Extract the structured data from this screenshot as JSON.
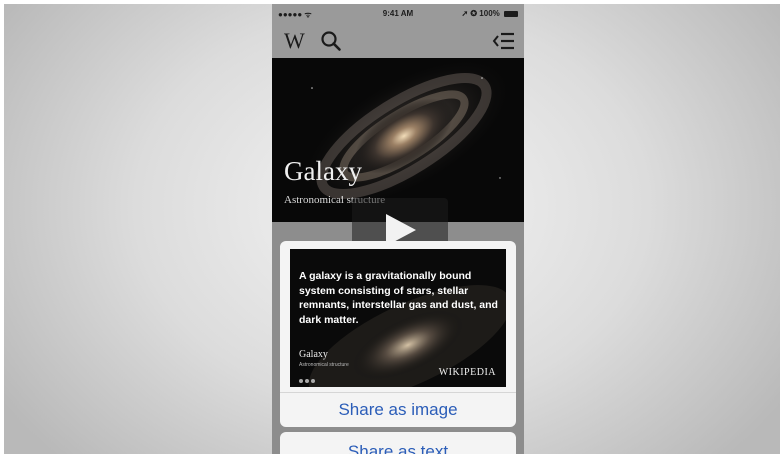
{
  "status_bar": {
    "signal": "●●●●● ᯤ",
    "time": "9:41 AM",
    "right": "➚ ✪ 100%"
  },
  "nav": {
    "logo": "W",
    "search_icon": "search-icon",
    "toc_icon": "toc-icon"
  },
  "article": {
    "title": "Galaxy",
    "subtitle": "Astronomical structure"
  },
  "video": {
    "play_icon": "play-icon"
  },
  "share_card": {
    "quote": "A galaxy is a gravitationally bound system consisting of stars, stellar remnants, interstellar gas and dust, and dark matter.",
    "title": "Galaxy",
    "subtitle": "Astronomical structure",
    "brand": "WIKIPEDIA"
  },
  "actions": {
    "share_image": "Share as image",
    "share_text": "Share as text"
  },
  "colors": {
    "action_blue": "#2b5db8",
    "chrome_gray": "#9a9a9a"
  }
}
